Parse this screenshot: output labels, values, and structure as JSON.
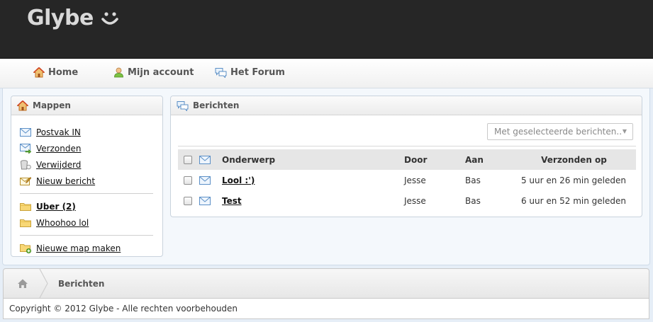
{
  "brand": {
    "logo_text": "Glybe"
  },
  "nav": {
    "items": [
      {
        "label": "Home",
        "icon": "home-icon"
      },
      {
        "label": "Mijn account",
        "icon": "user-icon"
      },
      {
        "label": "Het Forum",
        "icon": "speech-bubbles-icon"
      }
    ]
  },
  "sidebar": {
    "title": "Mappen",
    "folders": [
      {
        "label": "Postvak IN",
        "icon": "envelope-icon"
      },
      {
        "label": "Verzonden",
        "icon": "sent-mail-icon"
      },
      {
        "label": "Verwijderd",
        "icon": "trash-icon"
      },
      {
        "label": "Nieuw bericht",
        "icon": "compose-icon"
      }
    ],
    "custom_folders": [
      {
        "label": "Uber (2)",
        "icon": "folder-icon",
        "bold": true
      },
      {
        "label": "Whoohoo lol",
        "icon": "folder-icon",
        "bold": false
      }
    ],
    "new_folder_label": "Nieuwe map maken"
  },
  "messages": {
    "title": "Berichten",
    "bulk_action_placeholder": "Met geselecteerde berichten..",
    "columns": {
      "subject": "Onderwerp",
      "from": "Door",
      "to": "Aan",
      "sent": "Verzonden op"
    },
    "rows": [
      {
        "subject": "Lool :')",
        "from": "Jesse",
        "to": "Bas",
        "sent": "5 uur en 26 min geleden"
      },
      {
        "subject": "Test",
        "from": "Jesse",
        "to": "Bas",
        "sent": "6 uur en 52 min geleden"
      }
    ]
  },
  "breadcrumb": {
    "current": "Berichten"
  },
  "footer": {
    "copyright": "Copyright © 2012 Glybe - Alle rechten voorbehouden"
  },
  "colors": {
    "topbar": "#262626",
    "content_bg": "#f4f8fc",
    "logo": "#d9d9d9"
  }
}
